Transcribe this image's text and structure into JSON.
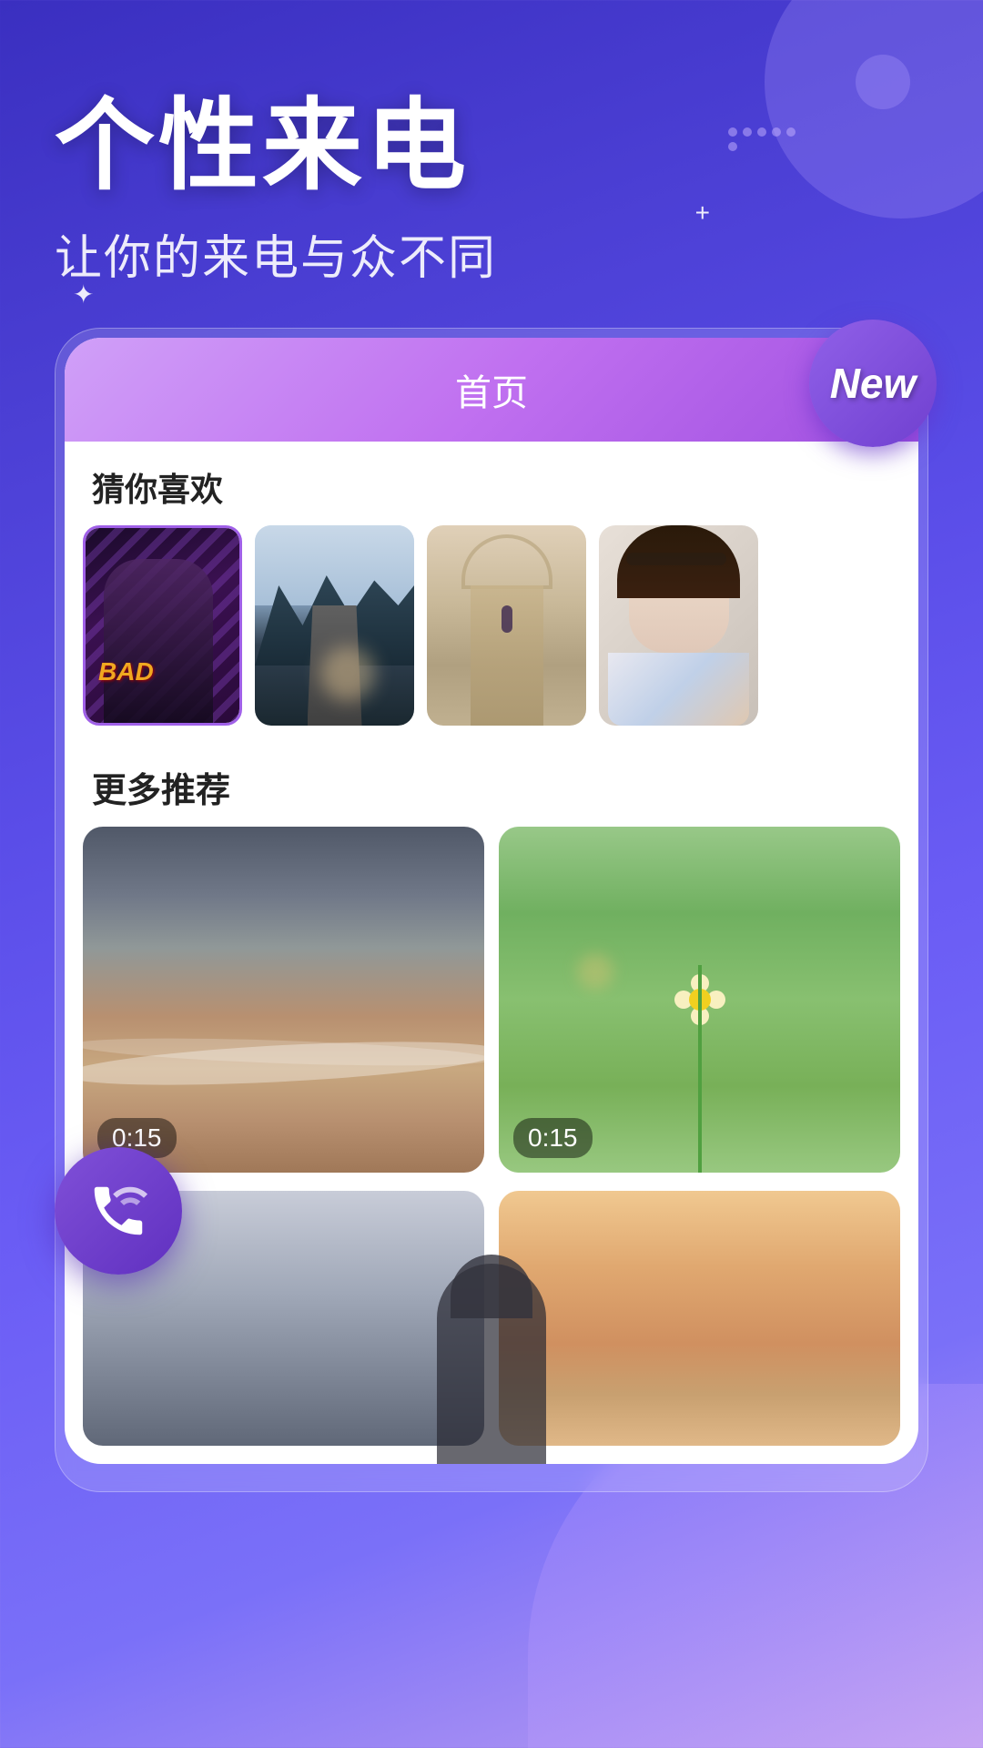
{
  "app": {
    "title": "个性来电",
    "subtitle": "让你的来电与众不同"
  },
  "card": {
    "tab_label": "首页",
    "new_badge": "New",
    "section1_title": "猜你喜欢",
    "section2_title": "更多推荐"
  },
  "thumbnails": [
    {
      "id": "thumb-1",
      "type": "girl-bad",
      "label": "BAD"
    },
    {
      "id": "thumb-2",
      "type": "mountain",
      "label": ""
    },
    {
      "id": "thumb-3",
      "type": "stairs",
      "label": ""
    },
    {
      "id": "thumb-4",
      "type": "girl2",
      "label": ""
    }
  ],
  "grid_items": [
    {
      "id": "grid-1",
      "type": "beach",
      "duration": "0:15"
    },
    {
      "id": "grid-2",
      "type": "flowers",
      "duration": "0:15"
    }
  ],
  "grid_items2": [
    {
      "id": "grid-3",
      "type": "person",
      "duration": ""
    },
    {
      "id": "grid-4",
      "type": "sunset",
      "duration": ""
    }
  ],
  "fab": {
    "label": "phone-call"
  },
  "colors": {
    "background_start": "#3a2fc0",
    "background_end": "#7a70f8",
    "card_gradient_start": "#d0a0f8",
    "card_gradient_end": "#a050e0",
    "new_badge": "#7040d0",
    "fab": "#6030c0"
  }
}
